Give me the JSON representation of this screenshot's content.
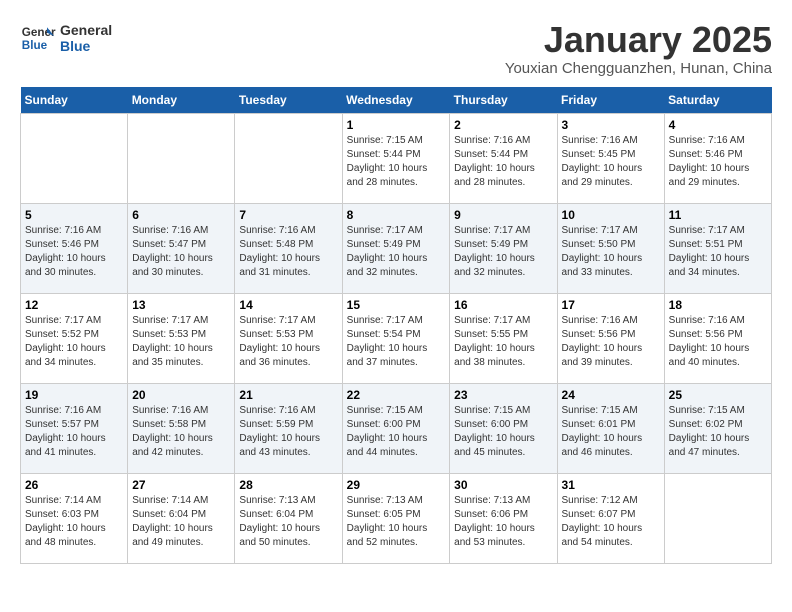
{
  "header": {
    "logo_line1": "General",
    "logo_line2": "Blue",
    "month_title": "January 2025",
    "location": "Youxian Chengguanzhen, Hunan, China"
  },
  "days_of_week": [
    "Sunday",
    "Monday",
    "Tuesday",
    "Wednesday",
    "Thursday",
    "Friday",
    "Saturday"
  ],
  "weeks": [
    [
      {
        "day": "",
        "info": ""
      },
      {
        "day": "",
        "info": ""
      },
      {
        "day": "",
        "info": ""
      },
      {
        "day": "1",
        "info": "Sunrise: 7:15 AM\nSunset: 5:44 PM\nDaylight: 10 hours\nand 28 minutes."
      },
      {
        "day": "2",
        "info": "Sunrise: 7:16 AM\nSunset: 5:44 PM\nDaylight: 10 hours\nand 28 minutes."
      },
      {
        "day": "3",
        "info": "Sunrise: 7:16 AM\nSunset: 5:45 PM\nDaylight: 10 hours\nand 29 minutes."
      },
      {
        "day": "4",
        "info": "Sunrise: 7:16 AM\nSunset: 5:46 PM\nDaylight: 10 hours\nand 29 minutes."
      }
    ],
    [
      {
        "day": "5",
        "info": "Sunrise: 7:16 AM\nSunset: 5:46 PM\nDaylight: 10 hours\nand 30 minutes."
      },
      {
        "day": "6",
        "info": "Sunrise: 7:16 AM\nSunset: 5:47 PM\nDaylight: 10 hours\nand 30 minutes."
      },
      {
        "day": "7",
        "info": "Sunrise: 7:16 AM\nSunset: 5:48 PM\nDaylight: 10 hours\nand 31 minutes."
      },
      {
        "day": "8",
        "info": "Sunrise: 7:17 AM\nSunset: 5:49 PM\nDaylight: 10 hours\nand 32 minutes."
      },
      {
        "day": "9",
        "info": "Sunrise: 7:17 AM\nSunset: 5:49 PM\nDaylight: 10 hours\nand 32 minutes."
      },
      {
        "day": "10",
        "info": "Sunrise: 7:17 AM\nSunset: 5:50 PM\nDaylight: 10 hours\nand 33 minutes."
      },
      {
        "day": "11",
        "info": "Sunrise: 7:17 AM\nSunset: 5:51 PM\nDaylight: 10 hours\nand 34 minutes."
      }
    ],
    [
      {
        "day": "12",
        "info": "Sunrise: 7:17 AM\nSunset: 5:52 PM\nDaylight: 10 hours\nand 34 minutes."
      },
      {
        "day": "13",
        "info": "Sunrise: 7:17 AM\nSunset: 5:53 PM\nDaylight: 10 hours\nand 35 minutes."
      },
      {
        "day": "14",
        "info": "Sunrise: 7:17 AM\nSunset: 5:53 PM\nDaylight: 10 hours\nand 36 minutes."
      },
      {
        "day": "15",
        "info": "Sunrise: 7:17 AM\nSunset: 5:54 PM\nDaylight: 10 hours\nand 37 minutes."
      },
      {
        "day": "16",
        "info": "Sunrise: 7:17 AM\nSunset: 5:55 PM\nDaylight: 10 hours\nand 38 minutes."
      },
      {
        "day": "17",
        "info": "Sunrise: 7:16 AM\nSunset: 5:56 PM\nDaylight: 10 hours\nand 39 minutes."
      },
      {
        "day": "18",
        "info": "Sunrise: 7:16 AM\nSunset: 5:56 PM\nDaylight: 10 hours\nand 40 minutes."
      }
    ],
    [
      {
        "day": "19",
        "info": "Sunrise: 7:16 AM\nSunset: 5:57 PM\nDaylight: 10 hours\nand 41 minutes."
      },
      {
        "day": "20",
        "info": "Sunrise: 7:16 AM\nSunset: 5:58 PM\nDaylight: 10 hours\nand 42 minutes."
      },
      {
        "day": "21",
        "info": "Sunrise: 7:16 AM\nSunset: 5:59 PM\nDaylight: 10 hours\nand 43 minutes."
      },
      {
        "day": "22",
        "info": "Sunrise: 7:15 AM\nSunset: 6:00 PM\nDaylight: 10 hours\nand 44 minutes."
      },
      {
        "day": "23",
        "info": "Sunrise: 7:15 AM\nSunset: 6:00 PM\nDaylight: 10 hours\nand 45 minutes."
      },
      {
        "day": "24",
        "info": "Sunrise: 7:15 AM\nSunset: 6:01 PM\nDaylight: 10 hours\nand 46 minutes."
      },
      {
        "day": "25",
        "info": "Sunrise: 7:15 AM\nSunset: 6:02 PM\nDaylight: 10 hours\nand 47 minutes."
      }
    ],
    [
      {
        "day": "26",
        "info": "Sunrise: 7:14 AM\nSunset: 6:03 PM\nDaylight: 10 hours\nand 48 minutes."
      },
      {
        "day": "27",
        "info": "Sunrise: 7:14 AM\nSunset: 6:04 PM\nDaylight: 10 hours\nand 49 minutes."
      },
      {
        "day": "28",
        "info": "Sunrise: 7:13 AM\nSunset: 6:04 PM\nDaylight: 10 hours\nand 50 minutes."
      },
      {
        "day": "29",
        "info": "Sunrise: 7:13 AM\nSunset: 6:05 PM\nDaylight: 10 hours\nand 52 minutes."
      },
      {
        "day": "30",
        "info": "Sunrise: 7:13 AM\nSunset: 6:06 PM\nDaylight: 10 hours\nand 53 minutes."
      },
      {
        "day": "31",
        "info": "Sunrise: 7:12 AM\nSunset: 6:07 PM\nDaylight: 10 hours\nand 54 minutes."
      },
      {
        "day": "",
        "info": ""
      }
    ]
  ]
}
